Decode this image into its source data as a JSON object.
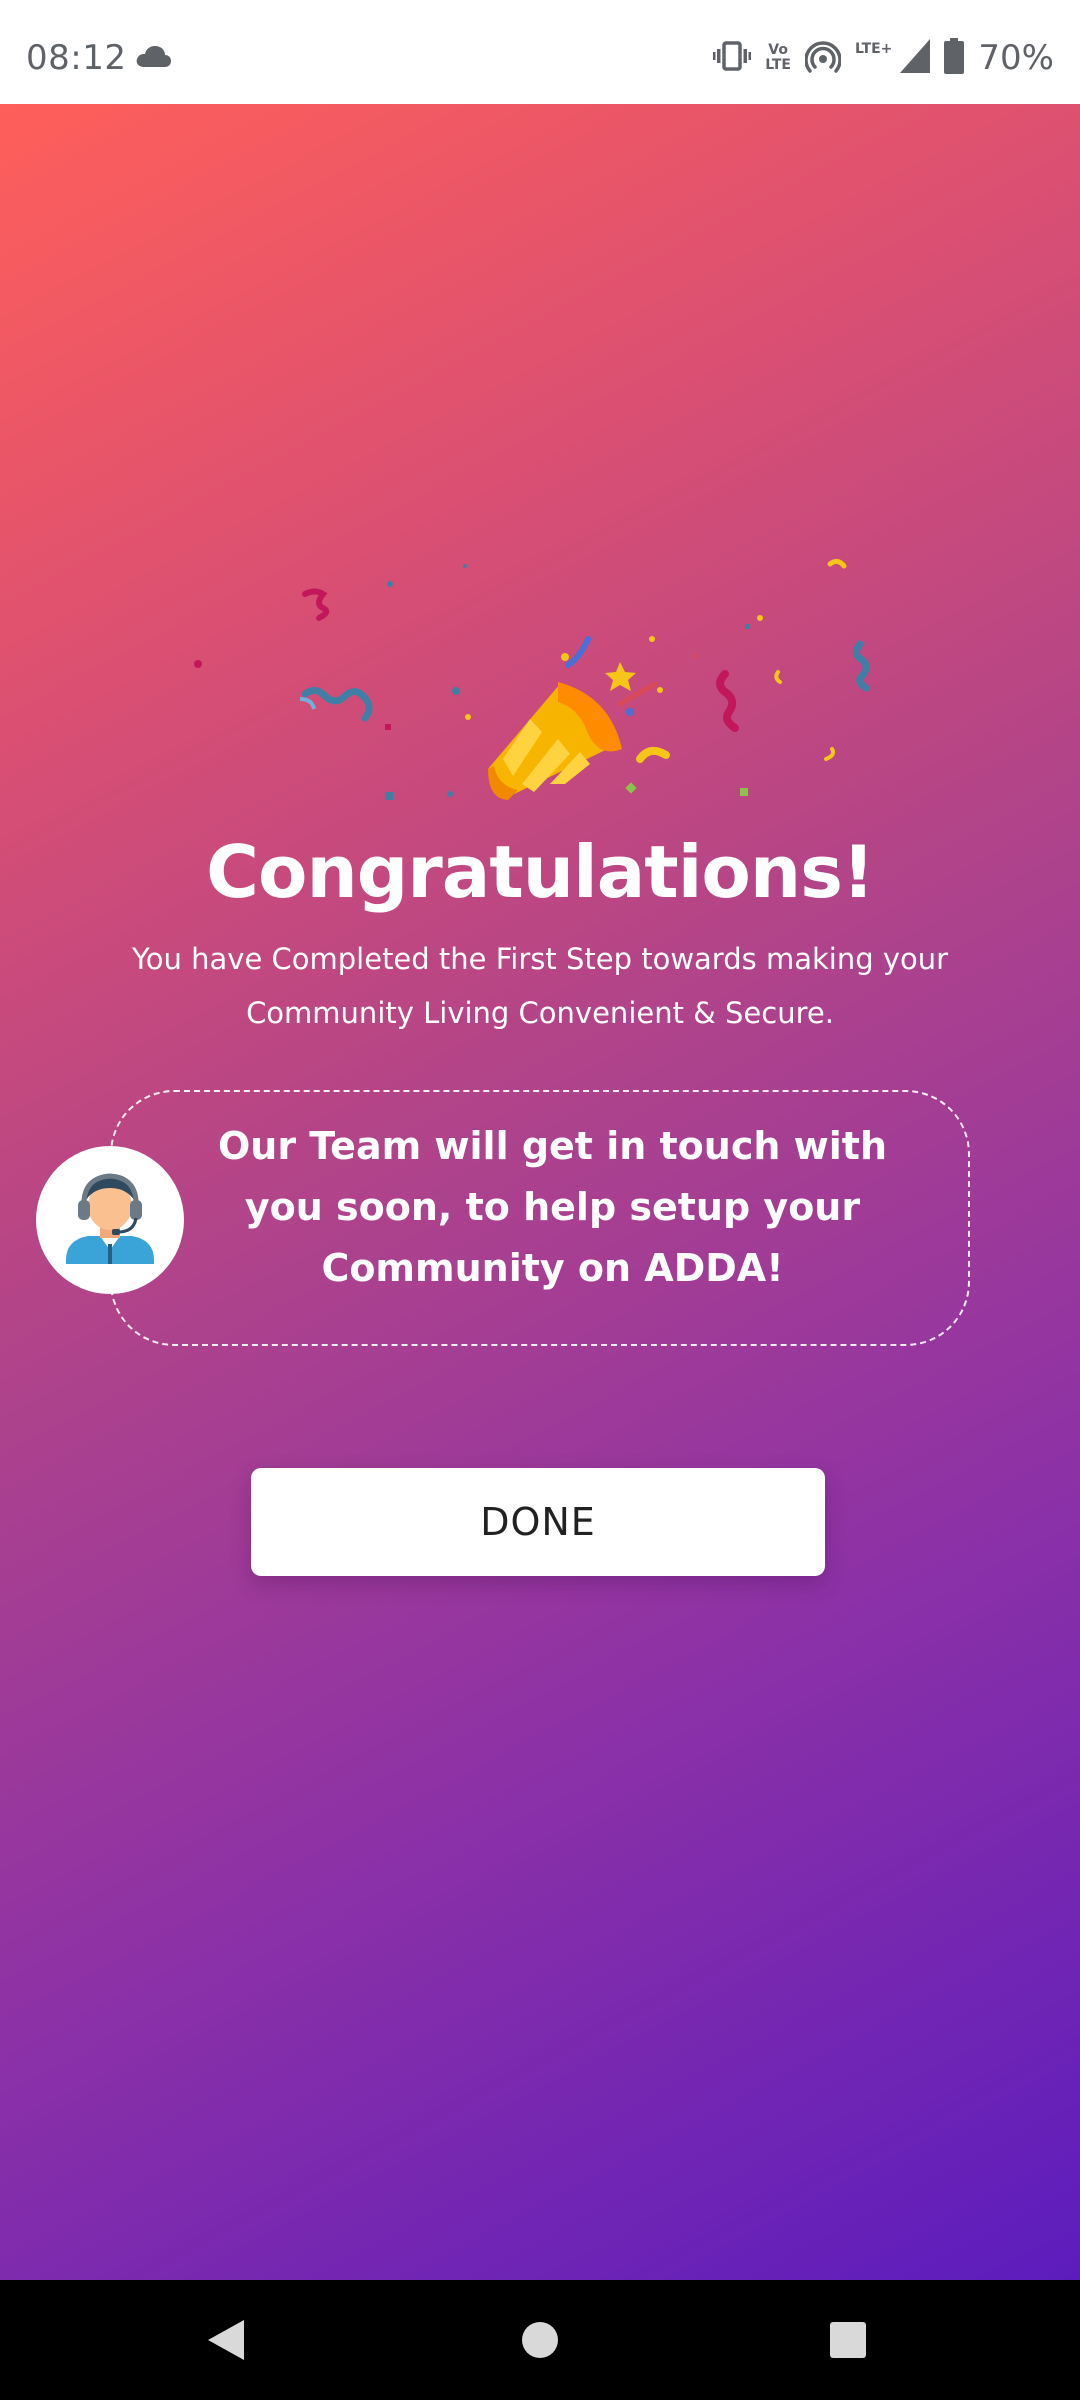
{
  "status_bar": {
    "time": "08:12",
    "volte_line1": "Vo",
    "volte_line2": "LTE",
    "lte_plus": "LTE+",
    "battery_percent": "70%",
    "icons": [
      "cloud-icon",
      "vibrate-icon",
      "volte-icon",
      "hotspot-icon",
      "signal-icon",
      "battery-icon"
    ]
  },
  "main": {
    "title": "Congratulations!",
    "subtitle": "You have Completed the First Step towards making your Community Living Convenient & Secure.",
    "team_message": "Our Team will get in touch with you soon, to help setup your Community on ADDA!",
    "done_label": "DONE",
    "gradient_colors": [
      "#ff5f5a",
      "#dc5071",
      "#b0438a",
      "#8a30a8",
      "#5c1cbd"
    ]
  },
  "nav_bar": {
    "icons": [
      "back-icon",
      "home-icon",
      "recents-icon"
    ]
  }
}
